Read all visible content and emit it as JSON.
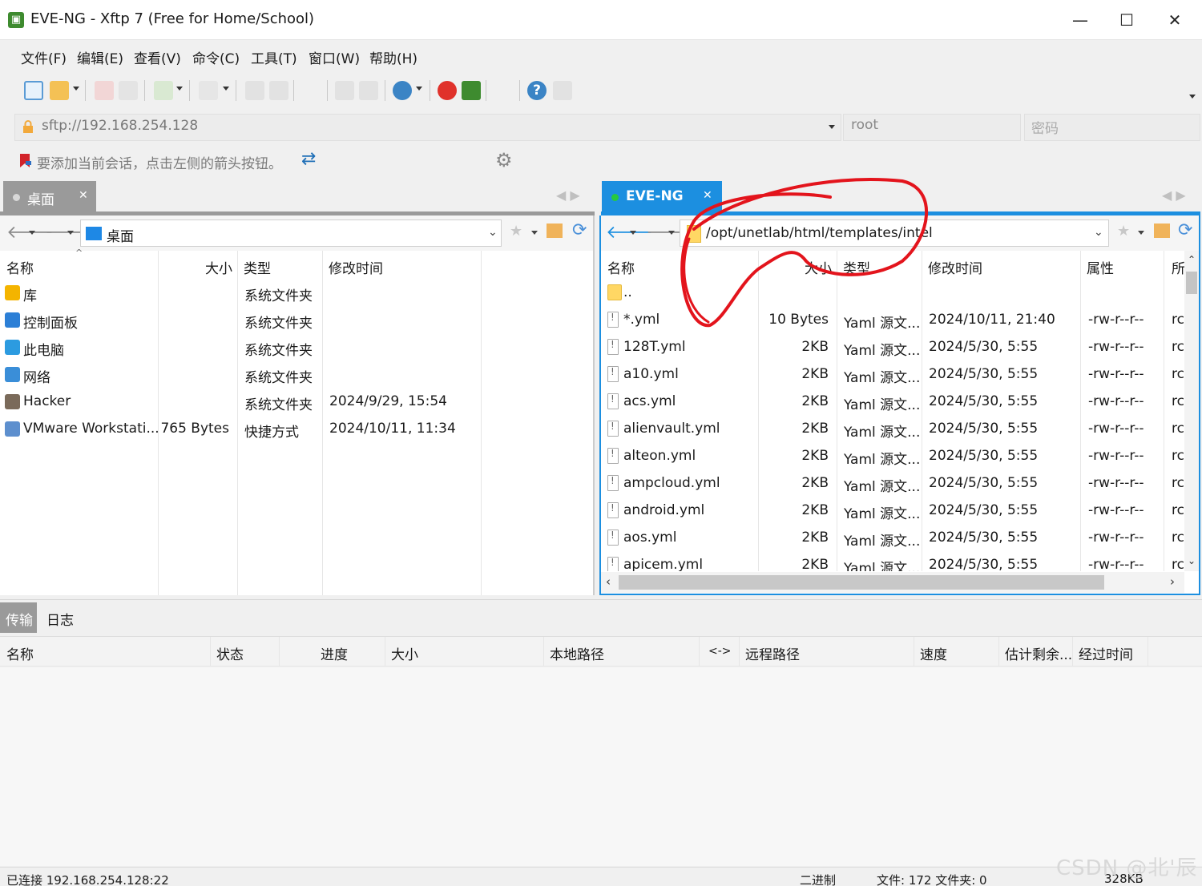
{
  "window": {
    "title": "EVE-NG - Xftp 7 (Free for Home/School)",
    "minimize": "—",
    "maximize": "☐",
    "close": "✕"
  },
  "menu": [
    "文件(F)",
    "编辑(E)",
    "查看(V)",
    "命令(C)",
    "工具(T)",
    "窗口(W)",
    "帮助(H)"
  ],
  "address": {
    "host": "sftp://192.168.254.128",
    "user_placeholder": "root",
    "password_placeholder": "密码"
  },
  "hint": "要添加当前会话，点击左侧的箭头按钮。",
  "left_pane": {
    "tab_label": "桌面",
    "path": "桌面",
    "columns": [
      "名称",
      "大小",
      "类型",
      "修改时间"
    ],
    "rows": [
      {
        "name": "库",
        "size": "",
        "type": "系统文件夹",
        "modified": "",
        "icon": "library-icon"
      },
      {
        "name": "控制面板",
        "size": "",
        "type": "系统文件夹",
        "modified": "",
        "icon": "control-panel-icon"
      },
      {
        "name": "此电脑",
        "size": "",
        "type": "系统文件夹",
        "modified": "",
        "icon": "computer-icon"
      },
      {
        "name": "网络",
        "size": "",
        "type": "系统文件夹",
        "modified": "",
        "icon": "network-icon"
      },
      {
        "name": "Hacker",
        "size": "",
        "type": "系统文件夹",
        "modified": "2024/9/29, 15:54",
        "icon": "user-icon"
      },
      {
        "name": "VMware Workstati...",
        "size": "765 Bytes",
        "type": "快捷方式",
        "modified": "2024/10/11, 11:34",
        "icon": "vmware-icon"
      }
    ]
  },
  "right_pane": {
    "tab_label": "EVE-NG",
    "path": "/opt/unetlab/html/templates/intel",
    "columns": [
      "名称",
      "大小",
      "类型",
      "修改时间",
      "属性",
      "所"
    ],
    "rows": [
      {
        "name": "..",
        "size": "",
        "type": "",
        "modified": "",
        "attr": "",
        "owner": "",
        "icon": "folder-icon"
      },
      {
        "name": "*.yml",
        "size": "10 Bytes",
        "type": "Yaml 源文...",
        "modified": "2024/10/11, 21:40",
        "attr": "-rw-r--r--",
        "owner": "rc",
        "icon": "file-icon"
      },
      {
        "name": "128T.yml",
        "size": "2KB",
        "type": "Yaml 源文...",
        "modified": "2024/5/30, 5:55",
        "attr": "-rw-r--r--",
        "owner": "rc",
        "icon": "file-icon"
      },
      {
        "name": "a10.yml",
        "size": "2KB",
        "type": "Yaml 源文...",
        "modified": "2024/5/30, 5:55",
        "attr": "-rw-r--r--",
        "owner": "rc",
        "icon": "file-icon"
      },
      {
        "name": "acs.yml",
        "size": "2KB",
        "type": "Yaml 源文...",
        "modified": "2024/5/30, 5:55",
        "attr": "-rw-r--r--",
        "owner": "rc",
        "icon": "file-icon"
      },
      {
        "name": "alienvault.yml",
        "size": "2KB",
        "type": "Yaml 源文...",
        "modified": "2024/5/30, 5:55",
        "attr": "-rw-r--r--",
        "owner": "rc",
        "icon": "file-icon"
      },
      {
        "name": "alteon.yml",
        "size": "2KB",
        "type": "Yaml 源文...",
        "modified": "2024/5/30, 5:55",
        "attr": "-rw-r--r--",
        "owner": "rc",
        "icon": "file-icon"
      },
      {
        "name": "ampcloud.yml",
        "size": "2KB",
        "type": "Yaml 源文...",
        "modified": "2024/5/30, 5:55",
        "attr": "-rw-r--r--",
        "owner": "rc",
        "icon": "file-icon"
      },
      {
        "name": "android.yml",
        "size": "2KB",
        "type": "Yaml 源文...",
        "modified": "2024/5/30, 5:55",
        "attr": "-rw-r--r--",
        "owner": "rc",
        "icon": "file-icon"
      },
      {
        "name": "aos.yml",
        "size": "2KB",
        "type": "Yaml 源文...",
        "modified": "2024/5/30, 5:55",
        "attr": "-rw-r--r--",
        "owner": "rc",
        "icon": "file-icon"
      },
      {
        "name": "apicem.yml",
        "size": "2KB",
        "type": "Yaml 源文...",
        "modified": "2024/5/30, 5:55",
        "attr": "-rw-r--r--",
        "owner": "rc",
        "icon": "file-icon"
      }
    ]
  },
  "transfer": {
    "tabs": [
      "传输",
      "日志"
    ],
    "columns": [
      "名称",
      "状态",
      "进度",
      "大小",
      "本地路径",
      "<->",
      "远程路径",
      "速度",
      "估计剩余...",
      "经过时间"
    ]
  },
  "status_bar": {
    "connection": "已连接 192.168.254.128:22",
    "mode": "二进制",
    "files": "文件: 172  文件夹: 0",
    "size": "328KB"
  },
  "watermark": "CSDN @北'辰",
  "colors": {
    "accent": "#1c8fe0",
    "annotation": "#e3141c"
  }
}
